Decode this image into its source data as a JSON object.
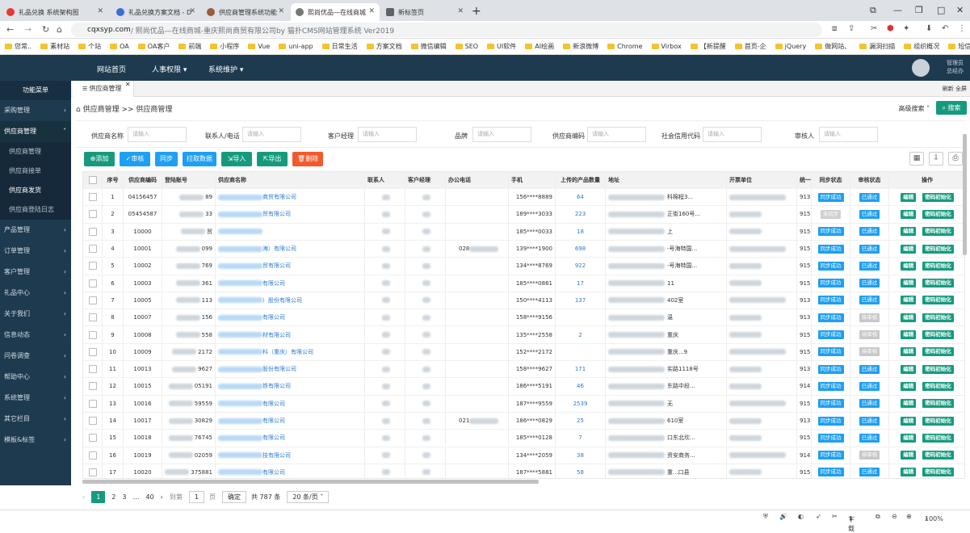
{
  "browser": {
    "tabs": [
      {
        "title": "礼品兑换 系统架构图",
        "icon_color": "#e53935",
        "active": false
      },
      {
        "title": "礼品兑换方案文档 - D",
        "icon_color": "#3b6fd6",
        "active": false
      },
      {
        "title": "供应商管理系统功能",
        "icon_color": "#9c5b3a",
        "active": false
      },
      {
        "title": "熙尚优品—在线商城",
        "icon_color": "#777777",
        "active": true
      },
      {
        "title": "新标签页",
        "icon_color": "#5f6368",
        "active": false
      }
    ],
    "url_domain": "cqxsyp.com",
    "url_path": " / 熙尚优品—在线商城-重庆熙尚商贸有限公司by 猫扑CMS网站管理系统 Ver2019",
    "bookmarks": [
      "您常..",
      "素材站",
      "个站",
      "OA",
      "OA客户",
      "前端",
      "小程序",
      "Vue",
      "uni-app",
      "日常生活",
      "方案文档",
      "微信编辑",
      "SEO",
      "UI软件",
      "AI绘画",
      "新浪微博",
      "Chrome",
      "Virbox",
      "【新提醒",
      "首页-企",
      "jQuery",
      "做网站、",
      "漏洞扫描",
      "组织概况",
      "短信案例"
    ]
  },
  "topnav": {
    "items": [
      "网站首页",
      "人事权限",
      "系统维护"
    ],
    "user_line1": "管理员",
    "user_line2": "总经办"
  },
  "sidebar": {
    "header": "功能菜单",
    "items": [
      "采购管理",
      "供应商管理",
      "产品管理",
      "订单管理",
      "客户管理",
      "礼品中心",
      "关于我们",
      "信息动态",
      "问卷调查",
      "帮助中心",
      "系统管理",
      "其它栏目",
      "模板&标签"
    ],
    "sub_items": [
      "供应商管理",
      "供应商接单",
      "供应商发货",
      "供应商登陆日志"
    ]
  },
  "page": {
    "tab": "供应商管理",
    "right_tools": "刷新  全屏",
    "breadcrumb": "供应商管理 >> 供应商管理",
    "advanced_search": "高级搜索 ˅",
    "search_button": "搜索",
    "filters": [
      {
        "label": "供应商名称",
        "placeholder": "请输入"
      },
      {
        "label": "联系人/电话",
        "placeholder": "请输入"
      },
      {
        "label": "客户经理",
        "placeholder": "请输入"
      },
      {
        "label": "品牌",
        "placeholder": "请输入"
      },
      {
        "label": "供应商编码",
        "placeholder": "请输入"
      },
      {
        "label": "社会信用代码",
        "placeholder": "请输入"
      },
      {
        "label": "审核人",
        "placeholder": "请输入"
      }
    ],
    "buttons": {
      "add": "添加",
      "audit": "审核",
      "sync": "同步",
      "pull": "拉取数据",
      "import": "导入",
      "export": "导出",
      "delete": "删除"
    }
  },
  "table": {
    "headers": [
      "序号",
      "供应商编码",
      "登陆账号",
      "供应商名称",
      "联系人",
      "客户经理",
      "办公电话",
      "手机",
      "上传的产品数量",
      "地址",
      "开票单位",
      "统一",
      "同步状态",
      "审核状态",
      "操作"
    ],
    "rows": [
      {
        "no": "1",
        "code": "04156457",
        "acct": "89",
        "name": "商贸有限公司",
        "office": "",
        "mobile": "156****8889",
        "count": "64",
        "addr": "科棉程3...",
        "sync": "同步成功",
        "audit": "已通过",
        "tax": "913"
      },
      {
        "no": "2",
        "code": "05454587",
        "acct": "33",
        "name": "贸有限公司",
        "office": "",
        "mobile": "189****3033",
        "count": "223",
        "addr": "正街160号...",
        "sync": "未同步",
        "audit": "已通过",
        "tax": "915"
      },
      {
        "no": "3",
        "code": "10000",
        "acct": "贸",
        "name": "",
        "office": "",
        "mobile": "185****0033",
        "count": "18",
        "addr": "上",
        "sync": "同步成功",
        "audit": "已通过",
        "tax": "915"
      },
      {
        "no": "4",
        "code": "10001",
        "acct": "099",
        "name": "海）有限公司",
        "office": "028",
        "mobile": "139****1900",
        "count": "698",
        "addr": "-号海特国...",
        "sync": "同步成功",
        "audit": "已通过",
        "tax": "915"
      },
      {
        "no": "5",
        "code": "10002",
        "acct": "769",
        "name": "贸有限公司",
        "office": "",
        "mobile": "134****8769",
        "count": "922",
        "addr": "-号海特国...",
        "sync": "同步成功",
        "audit": "已通过",
        "tax": "915"
      },
      {
        "no": "6",
        "code": "10003",
        "acct": "361",
        "name": "有限公司",
        "office": "",
        "mobile": "185****0861",
        "count": "17",
        "addr": "11",
        "sync": "同步成功",
        "audit": "已通过",
        "tax": "915"
      },
      {
        "no": "7",
        "code": "10005",
        "acct": "113",
        "name": "）股份有限公司",
        "office": "",
        "mobile": "150****4113",
        "count": "137",
        "addr": "402室",
        "sync": "同步成功",
        "audit": "已通过",
        "tax": "913"
      },
      {
        "no": "8",
        "code": "10007",
        "acct": "156",
        "name": "有限公司",
        "office": "",
        "mobile": "158****9156",
        "count": "",
        "addr": "温",
        "sync": "同步成功",
        "audit": "待审核",
        "tax": "913"
      },
      {
        "no": "9",
        "code": "10008",
        "acct": "558",
        "name": "材有限公司",
        "office": "",
        "mobile": "135****2558",
        "count": "2",
        "addr": "重庆",
        "sync": "同步成功",
        "audit": "待审核",
        "tax": "915"
      },
      {
        "no": "10",
        "code": "10009",
        "acct": "2172",
        "name": "科（重庆）有限公司",
        "office": "",
        "mobile": "152****2172",
        "count": "",
        "addr": "重庆...9",
        "sync": "同步成功",
        "audit": "待审核",
        "tax": "915"
      },
      {
        "no": "11",
        "code": "10013",
        "acct": "9627",
        "name": "股份有限公司",
        "office": "",
        "mobile": "158****9627",
        "count": "171",
        "addr": "实路1118号",
        "sync": "同步成功",
        "audit": "已通过",
        "tax": "913"
      },
      {
        "no": "12",
        "code": "10015",
        "acct": "05191",
        "name": "铁有限公司",
        "office": "",
        "mobile": "186****5191",
        "count": "46",
        "addr": "东路中段...",
        "sync": "同步成功",
        "audit": "已通过",
        "tax": "914"
      },
      {
        "no": "13",
        "code": "10016",
        "acct": "59559",
        "name": "有限公司",
        "office": "",
        "mobile": "187****9559",
        "count": "2539",
        "addr": "无",
        "sync": "同步成功",
        "audit": "已通过",
        "tax": "915"
      },
      {
        "no": "14",
        "code": "10017",
        "acct": "30829",
        "name": "有限公司",
        "office": "021",
        "mobile": "186****0829",
        "count": "25",
        "addr": "610室",
        "sync": "同步成功",
        "audit": "已通过",
        "tax": "913"
      },
      {
        "no": "15",
        "code": "10018",
        "acct": "76745",
        "name": "有限公司",
        "office": "",
        "mobile": "185****0128",
        "count": "7",
        "addr": "口东北坎...",
        "sync": "同步成功",
        "audit": "已通过",
        "tax": "915"
      },
      {
        "no": "16",
        "code": "10019",
        "acct": "02059",
        "name": "技有限公司",
        "office": "",
        "mobile": "134****2059",
        "count": "38",
        "addr": "资安商务...",
        "sync": "同步成功",
        "audit": "待审核",
        "tax": "914"
      },
      {
        "no": "17",
        "code": "10020",
        "acct": "375881",
        "name": "有限公司",
        "office": "",
        "mobile": "187****5881",
        "count": "58",
        "addr": "重...口县",
        "sync": "同步成功",
        "audit": "已通过",
        "tax": "915"
      }
    ],
    "edit_label": "编辑",
    "reset_label": "密码初始化"
  },
  "pager": {
    "pages": [
      "1",
      "2",
      "3",
      "…",
      "40"
    ],
    "goto_label": "到第",
    "goto_value": "1",
    "page_unit": "页",
    "confirm": "确定",
    "total": "共 787 条",
    "per_page": "20 条/页 ˅"
  },
  "statusbar": {
    "download": "下载",
    "zoom": "100%"
  }
}
